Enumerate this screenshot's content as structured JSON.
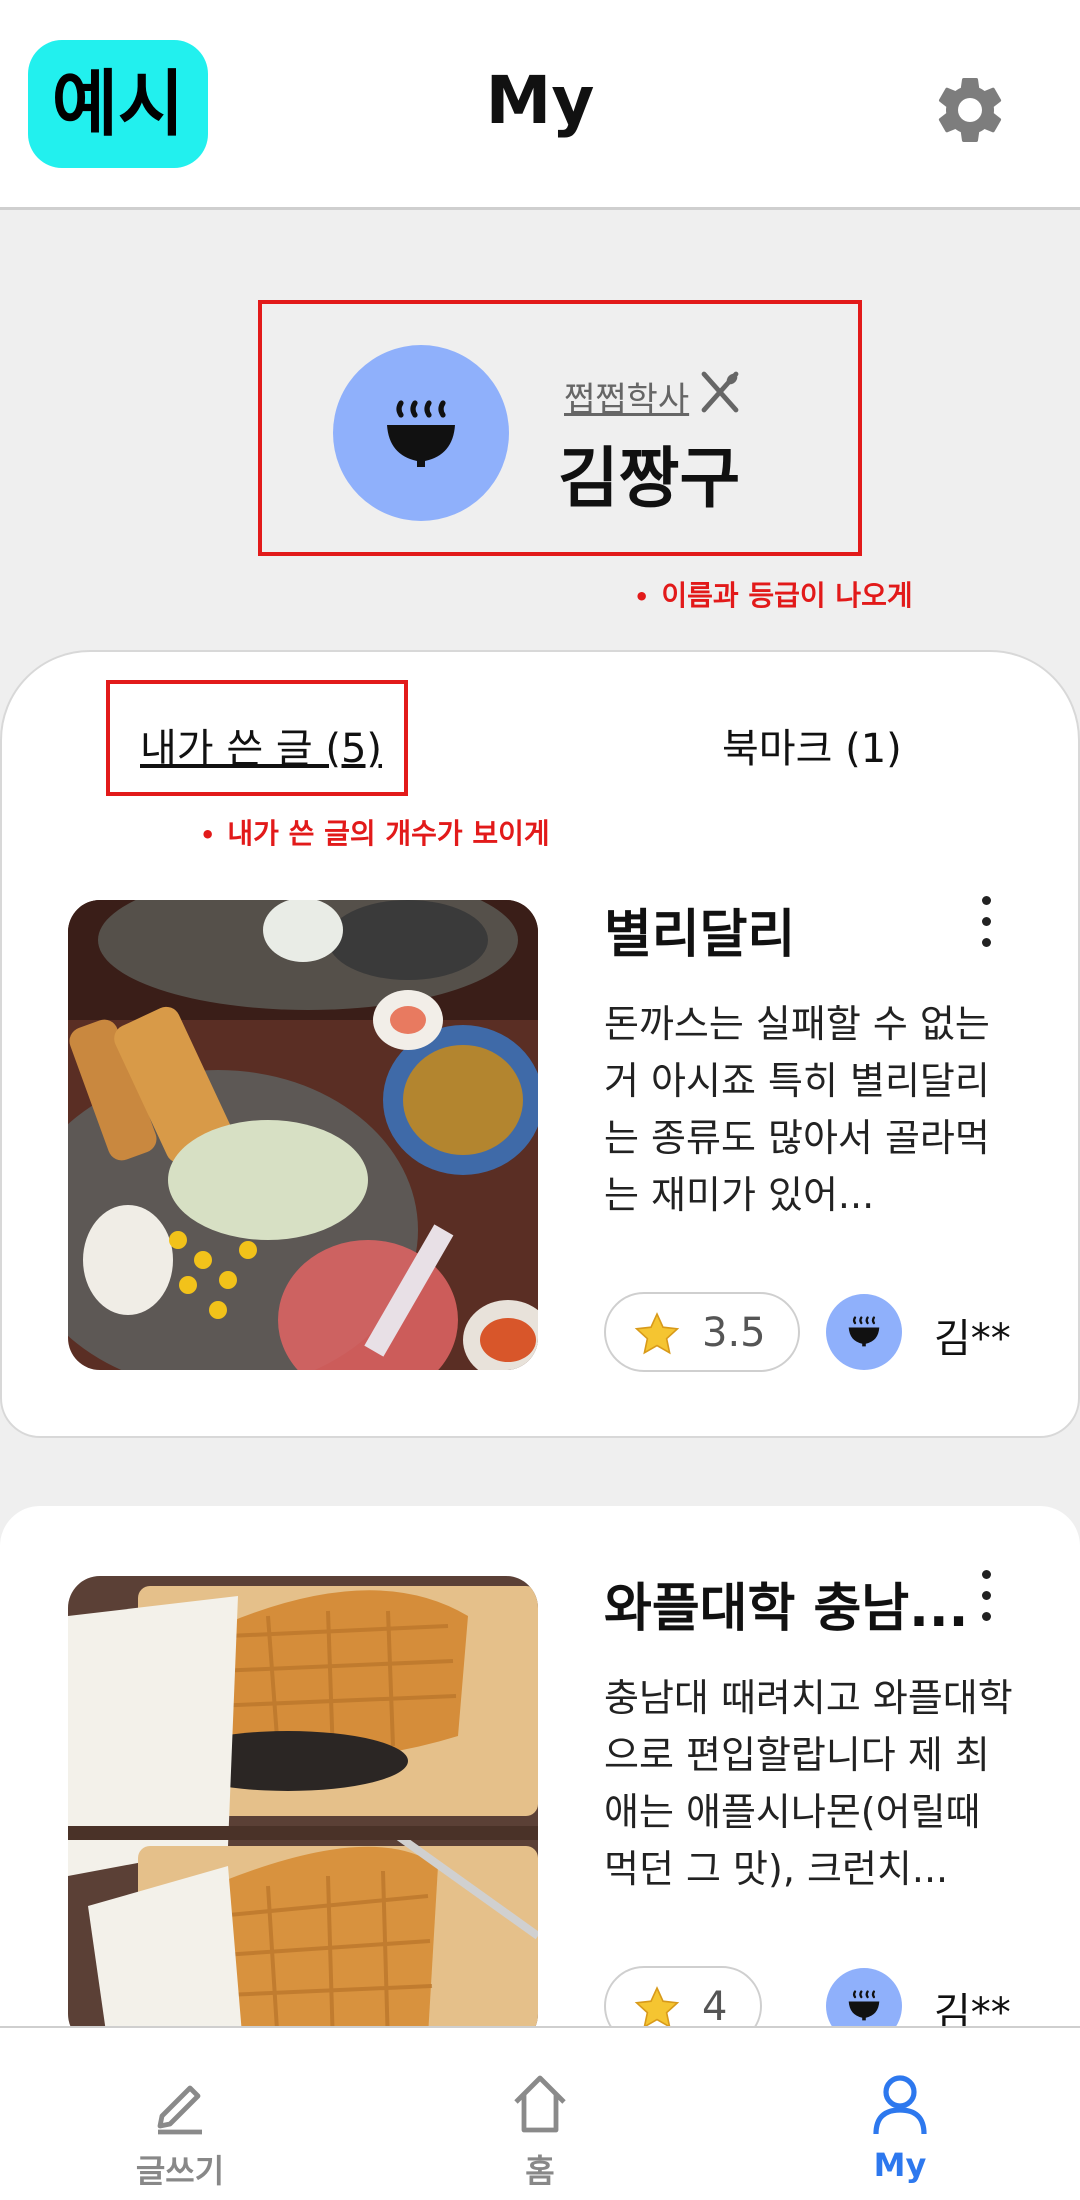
{
  "colors": {
    "accent": "#22f0ee",
    "avatar": "#8fb0fb",
    "annotation": "#e21a1a",
    "active_nav": "#2d78ee"
  },
  "header": {
    "badge": "예시",
    "title": "My",
    "settings_icon": "gear-icon"
  },
  "profile": {
    "grade": "쩝쩝학사",
    "name": "김짱구",
    "avatar_icon": "rice-bowl-icon",
    "grade_icon": "fork-knife-icon"
  },
  "annotations": {
    "profile_note": "이름과 등급이 나오게",
    "tab_note": "내가 쓴 글의 개수가 보이게"
  },
  "tabs": [
    {
      "label": "내가 쓴 글 (5)",
      "selected": true
    },
    {
      "label": "북마크 (1)",
      "selected": false
    }
  ],
  "posts": [
    {
      "title": "별리달리",
      "body": "돈까스는 실패할 수 없는 거 아시죠 특히 별리달리는 종류도 많아서 골라먹는 재미가 있어...",
      "rating": "3.5",
      "author": "김**"
    },
    {
      "title": "와플대학 충남...",
      "body": "충남대 때려치고 와플대학으로 편입할랍니다 제 최애는 애플시나몬(어릴때 먹던 그 맛), 크런치...",
      "rating": "4",
      "author": "김**"
    }
  ],
  "nav": [
    {
      "label": "글쓰기",
      "icon": "pencil-icon"
    },
    {
      "label": "홈",
      "icon": "home-icon"
    },
    {
      "label": "My",
      "icon": "person-icon",
      "active": true
    }
  ]
}
